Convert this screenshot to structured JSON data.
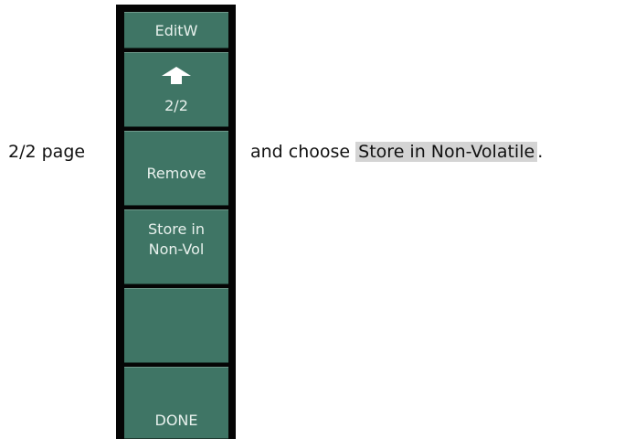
{
  "caption": {
    "left_text": "2/2 page",
    "right_text": "and choose",
    "highlight_text": "Store in Non-Volatile",
    "trailing": "."
  },
  "softmenu": {
    "header": "EditW",
    "page_indicator": "2/2",
    "page_icon": "up-arrow-icon",
    "remove": "Remove",
    "store_line1": "Store in",
    "store_line2": "Non-Vol",
    "empty": "",
    "done": "DONE"
  },
  "colors": {
    "button_fill": "#3f7565",
    "panel_bg": "#050505",
    "button_text": "#e8f1ed",
    "highlight_bg": "#d4d4d4"
  }
}
